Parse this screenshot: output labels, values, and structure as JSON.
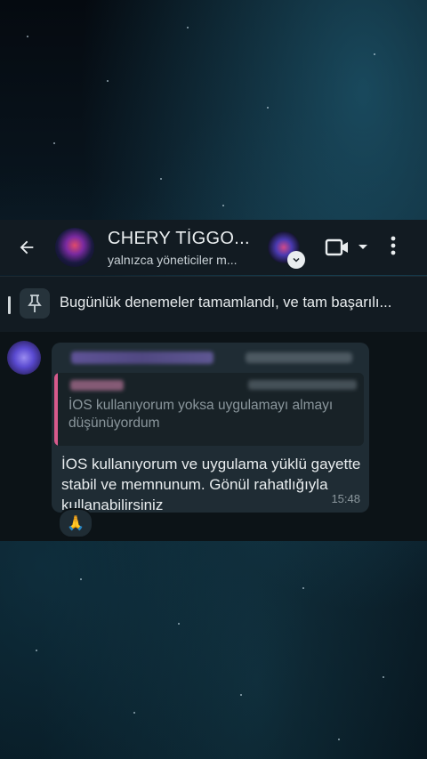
{
  "header": {
    "title": "CHERY TİGGO...",
    "subtitle": "yalnızca yöneticiler m...",
    "back_icon": "arrow-left-icon",
    "video_icon": "video-camera-icon",
    "menu_icon": "more-vertical-icon"
  },
  "pinned": {
    "text": "Bugünlük denemeler tamamlandı, ve tam başarılı..."
  },
  "message": {
    "quote_text": "İOS kullanıyorum yoksa uygulamayı almayı düşünüyordum",
    "body": "İOS kullanıyorum ve uygulama yüklü gayette stabil ve memnunum. Gönül rahatlığıyla kullanabilirsiniz",
    "time": "15:48",
    "reaction": "🙏"
  },
  "colors": {
    "appbar": "#121b22",
    "bubble": "#1f2c34",
    "quote_accent": "#d75a8c"
  }
}
